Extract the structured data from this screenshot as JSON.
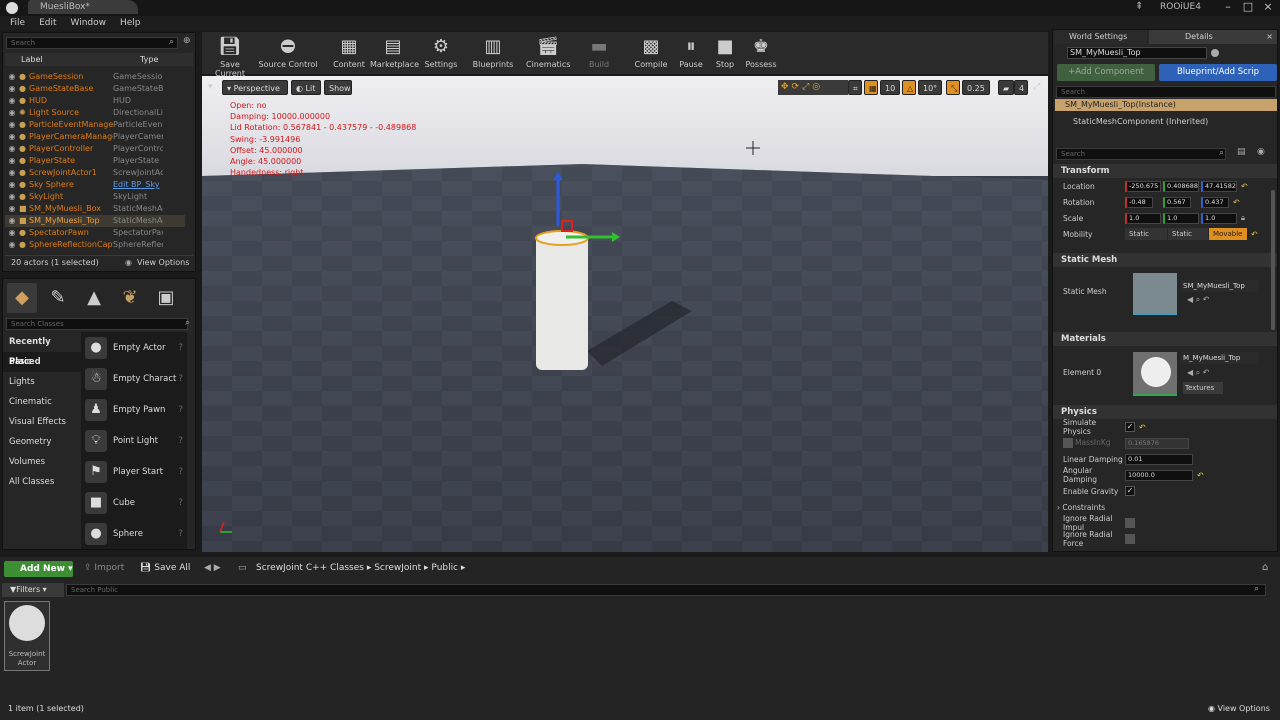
{
  "window": {
    "tab_title": "MuesliBox*",
    "app_name": "ROOiUE4"
  },
  "menu": [
    "File",
    "Edit",
    "Window",
    "Help"
  ],
  "outliner": {
    "search_placeholder": "Search",
    "col_label": "Label",
    "col_type": "Type",
    "rows": [
      {
        "label": "GameSession",
        "type": "GameSession"
      },
      {
        "label": "GameStateBase",
        "type": "GameStateBase"
      },
      {
        "label": "HUD",
        "type": "HUD"
      },
      {
        "label": "Light Source",
        "type": "DirectionalLi"
      },
      {
        "label": "ParticleEventManager",
        "type": "ParticleEvent"
      },
      {
        "label": "PlayerCameraManager",
        "type": "PlayerCamer"
      },
      {
        "label": "PlayerController",
        "type": "PlayerContro"
      },
      {
        "label": "PlayerState",
        "type": "PlayerState"
      },
      {
        "label": "ScrewJointActor1",
        "type": "ScrewJointAc"
      },
      {
        "label": "Sky Sphere",
        "type": "Edit BP_Sky"
      },
      {
        "label": "SkyLight",
        "type": "SkyLight"
      },
      {
        "label": "SM_MyMuesli_Box",
        "type": "StaticMeshAc"
      },
      {
        "label": "SM_MyMuesli_Top",
        "type": "StaticMeshAc"
      },
      {
        "label": "SpectatorPawn",
        "type": "SpectatorPaw"
      },
      {
        "label": "SphereReflectionCapture",
        "type": "SphereReflect"
      }
    ],
    "footer": "20 actors (1 selected)",
    "view_options": "View Options"
  },
  "place": {
    "search_placeholder": "Search Classes",
    "categories": [
      "Recently Placed",
      "Basic",
      "Lights",
      "Cinematic",
      "Visual Effects",
      "Geometry",
      "Volumes",
      "All Classes"
    ],
    "items": [
      "Empty Actor",
      "Empty Charact",
      "Empty Pawn",
      "Point Light",
      "Player Start",
      "Cube",
      "Sphere"
    ]
  },
  "toolbar": [
    "Save Current",
    "Source Control",
    "Content",
    "Marketplace",
    "Settings",
    "Blueprints",
    "Cinematics",
    "Build",
    "Compile",
    "Pause",
    "Stop",
    "Possess"
  ],
  "viewport": {
    "perspective": "Perspective",
    "lit": "Lit",
    "show": "Show",
    "grid_snap": "10",
    "rot_snap": "10°",
    "scale_snap": "0.25",
    "cam_speed": "4",
    "debug": [
      "Open: no",
      "Damping: 10000.000000",
      "Lid Rotation: 0.567841 - 0.437579 - -0.489868",
      "Swing: -3.991496",
      "Offset: 45.000000",
      "Angle: 45.000000",
      "Handedness: right"
    ]
  },
  "details": {
    "tab_world": "World Settings",
    "tab_details": "Details",
    "actor_name": "SM_MyMuesli_Top",
    "add_component": "+Add Component",
    "blueprint_btn": "Blueprint/Add Scrip",
    "search_placeholder": "Search",
    "instance": "SM_MyMuesli_Top(Instance)",
    "component": "StaticMeshComponent (Inherited)",
    "transform_title": "Transform",
    "location_label": "Location",
    "location": [
      "-250.675",
      "0.408688",
      "47.41582"
    ],
    "rotation_label": "Rotation",
    "rotation": [
      "-0.48",
      "0.567",
      "0.437"
    ],
    "scale_label": "Scale",
    "scale": [
      "1.0",
      "1.0",
      "1.0"
    ],
    "mobility_label": "Mobility",
    "mobility": [
      "Static",
      "Static",
      "Movable"
    ],
    "static_mesh_title": "Static Mesh",
    "static_mesh_label": "Static Mesh",
    "static_mesh_value": "SM_MyMuesli_Top",
    "materials_title": "Materials",
    "element0_label": "Element 0",
    "element0_value": "M_MyMuesli_Top",
    "textures": "Textures",
    "physics_title": "Physics",
    "simulate": "Simulate Physics",
    "mass_label": "MassInKg",
    "mass": "0.165876",
    "linear_damping_label": "Linear Damping",
    "linear_damping": "0.01",
    "angular_damping_label": "Angular Damping",
    "angular_damping": "10000.0",
    "gravity": "Enable Gravity",
    "constraints": "Constraints",
    "radial_impulse": "Ignore Radial Impul",
    "radial_force": "Ignore Radial Force"
  },
  "content": {
    "add_new": "Add New",
    "import": "Import",
    "save_all": "Save All",
    "path": [
      "ScrewJoint C++ Classes",
      "ScrewJoint",
      "Public"
    ],
    "filters": "Filters",
    "search_placeholder": "Search Public",
    "asset_label": "ScrewJoint Actor",
    "footer": "1 item (1 selected)",
    "view_options": "View Options"
  }
}
